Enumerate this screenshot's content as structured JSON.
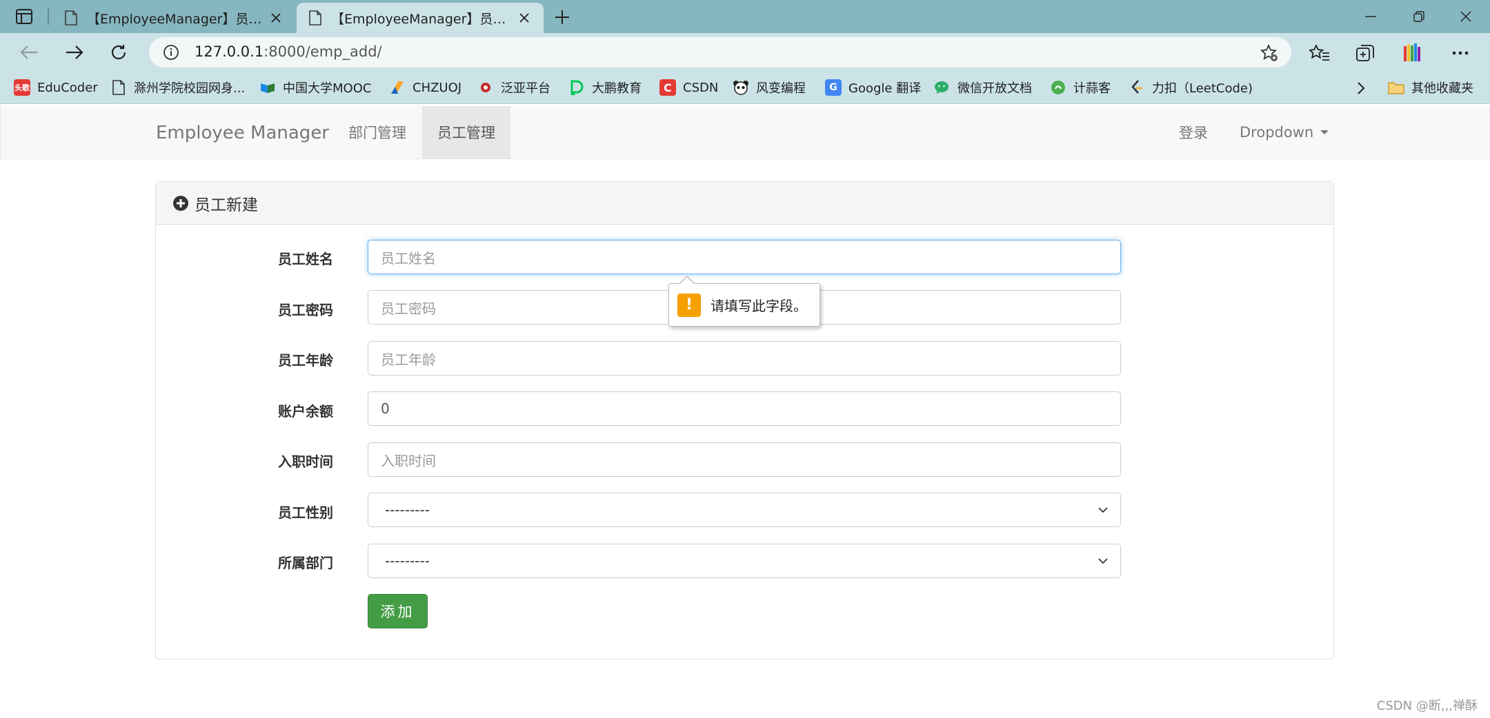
{
  "browser": {
    "tabs": [
      {
        "title": "【EmployeeManager】员工列表"
      },
      {
        "title": "【EmployeeManager】员工新建"
      }
    ],
    "url_host": "127.0.0.1",
    "url_rest": ":8000/emp_add/",
    "bookmarks": [
      {
        "label": "EduCoder",
        "icon": "educoder-icon",
        "badge": "头歌",
        "color": "#e53935"
      },
      {
        "label": "滁州学院校园网身...",
        "icon": "page-icon",
        "badge": "",
        "color": ""
      },
      {
        "label": "中国大学MOOC",
        "icon": "mooc-icon",
        "badge": "",
        "color": "#2e7d32"
      },
      {
        "label": "CHZUOJ",
        "icon": "chzuoj-icon",
        "badge": "",
        "color": "#f9a825"
      },
      {
        "label": "泛亚平台",
        "icon": "fanya-icon",
        "badge": "",
        "color": "#c62828"
      },
      {
        "label": "大鹏教育",
        "icon": "dapeng-icon",
        "badge": "",
        "color": "#00c853"
      },
      {
        "label": "CSDN",
        "icon": "csdn-icon",
        "badge": "C",
        "color": "#e53935"
      },
      {
        "label": "风变编程",
        "icon": "panda-icon",
        "badge": "",
        "color": "#333333"
      },
      {
        "label": "Google 翻译",
        "icon": "google-translate-icon",
        "badge": "G",
        "color": "#4285f4"
      },
      {
        "label": "微信开放文档",
        "icon": "wechat-icon",
        "badge": "",
        "color": "#2aae67"
      },
      {
        "label": "计蒜客",
        "icon": "jisuanke-icon",
        "badge": "",
        "color": "#4caf50"
      },
      {
        "label": "力扣（LeetCode)",
        "icon": "leetcode-icon",
        "badge": "",
        "color": "#333333"
      }
    ],
    "other_bookmarks": "其他收藏夹"
  },
  "navbar": {
    "brand": "Employee Manager",
    "links": [
      "部门管理",
      "员工管理"
    ],
    "login": "登录",
    "dropdown": "Dropdown"
  },
  "panel": {
    "title": "员工新建",
    "fields": [
      {
        "label": "员工姓名",
        "placeholder": "员工姓名",
        "value": ""
      },
      {
        "label": "员工密码",
        "placeholder": "员工密码",
        "value": ""
      },
      {
        "label": "员工年龄",
        "placeholder": "员工年龄",
        "value": ""
      },
      {
        "label": "账户余额",
        "placeholder": "",
        "value": "0"
      },
      {
        "label": "入职时间",
        "placeholder": "入职时间",
        "value": ""
      },
      {
        "label": "员工性别",
        "placeholder": "",
        "value": "---------"
      },
      {
        "label": "所属部门",
        "placeholder": "",
        "value": "---------"
      }
    ],
    "submit": "添加"
  },
  "tooltip": {
    "message": "请填写此字段。"
  },
  "watermark": "CSDN @断,,,禅酥"
}
